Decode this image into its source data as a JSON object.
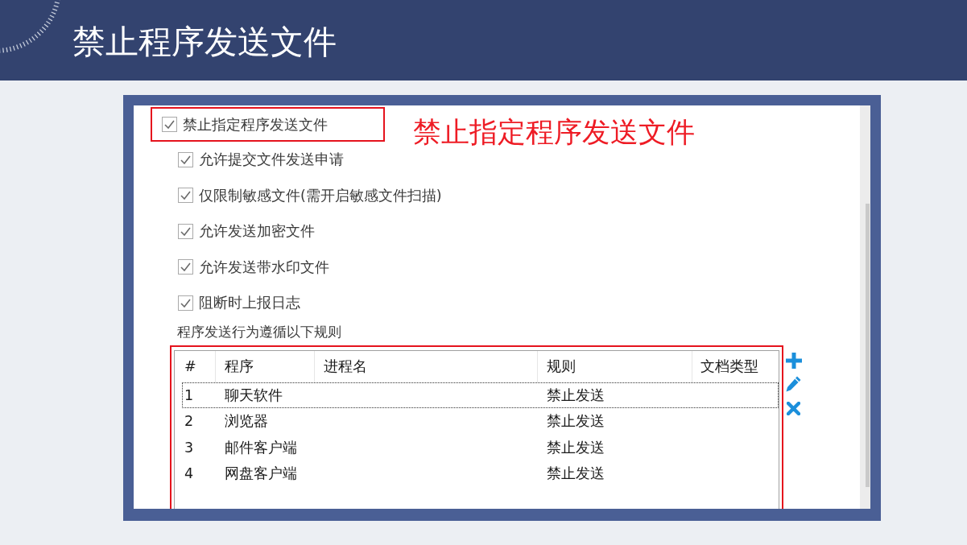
{
  "header": {
    "title": "禁止程序发送文件"
  },
  "panel": {
    "main_option": {
      "label": "禁止指定程序发送文件",
      "checked": true,
      "highlighted": true
    },
    "callout": "禁止指定程序发送文件",
    "options": [
      {
        "label": "允许提交文件发送申请",
        "checked": true
      },
      {
        "label": "仅限制敏感文件(需开启敏感文件扫描)",
        "checked": true
      },
      {
        "label": "允许发送加密文件",
        "checked": true
      },
      {
        "label": "允许发送带水印文件",
        "checked": true
      },
      {
        "label": "阻断时上报日志",
        "checked": true
      }
    ],
    "rules_caption": "程序发送行为遵循以下规则",
    "rules_table": {
      "highlighted": true,
      "columns": [
        "#",
        "程序",
        "进程名",
        "规则",
        "文档类型"
      ],
      "rows": [
        {
          "number": "1",
          "program": "聊天软件",
          "rule": "禁止发送",
          "focused": true
        },
        {
          "number": "2",
          "program": "浏览器",
          "rule": "禁止发送",
          "focused": false
        },
        {
          "number": "3",
          "program": "邮件客户端",
          "rule": "禁止发送",
          "focused": false
        },
        {
          "number": "4",
          "program": "网盘客户端",
          "rule": "禁止发送",
          "focused": false
        }
      ]
    }
  }
}
